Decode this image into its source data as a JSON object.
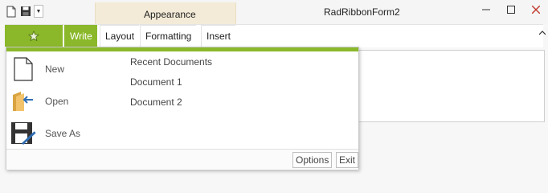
{
  "window": {
    "title": "RadRibbonForm2",
    "context_tab": "Appearance"
  },
  "ribbon": {
    "tabs": [
      {
        "label": "Write",
        "active": true
      },
      {
        "label": "Layout"
      },
      {
        "label": "Formatting"
      },
      {
        "label": "Insert"
      }
    ]
  },
  "app_menu": {
    "items": [
      {
        "label": "New",
        "icon": "new-document-icon"
      },
      {
        "label": "Open",
        "icon": "open-folder-icon"
      },
      {
        "label": "Save As",
        "icon": "save-as-icon"
      }
    ],
    "recent_title": "Recent Documents",
    "recent_items": [
      "Document 1",
      "Document 2"
    ],
    "options_label": "Options",
    "exit_label": "Exit"
  },
  "colors": {
    "accent": "#8ab82a",
    "context_tab": "#f3ebd7",
    "close_button": "#c0392b"
  }
}
